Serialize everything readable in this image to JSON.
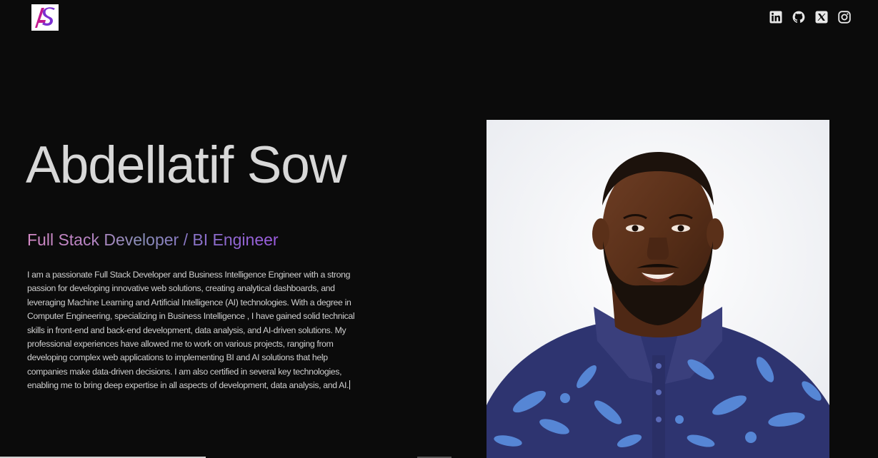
{
  "header": {
    "logo_text": "AS",
    "socials": [
      {
        "icon": "linkedin-icon",
        "label": "LinkedIn"
      },
      {
        "icon": "github-icon",
        "label": "GitHub"
      },
      {
        "icon": "x-icon",
        "label": "X"
      },
      {
        "icon": "instagram-icon",
        "label": "Instagram"
      }
    ]
  },
  "hero": {
    "name": "Abdellatif Sow",
    "role": "Full Stack Developer / BI Engineer",
    "bio": "I am a passionate Full Stack Developer and Business Intelligence Engineer with a strong passion for developing innovative web solutions, creating analytical dashboards, and leveraging Machine Learning and Artificial Intelligence (AI) technologies. With a degree in Computer Engineering, specializing in Business Intelligence , I have gained solid technical skills in front-end and back-end development, data analysis, and AI-driven solutions. My professional experiences have allowed me to work on various projects, ranging from developing complex web applications to implementing BI and AI solutions that help companies make data-driven decisions. I am also certified in several key technologies, enabling me to bring deep expertise in all aspects of development, data analysis, and AI."
  },
  "colors": {
    "background": "#0b0b0b",
    "name": "#d8d8d8",
    "role_gradient_start": "#d48ac6",
    "role_gradient_end": "#9c5ce0",
    "logo_accent": "#c2188f"
  }
}
